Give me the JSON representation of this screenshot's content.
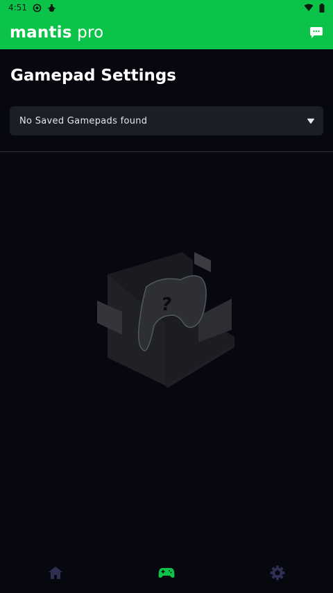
{
  "status_bar": {
    "time": "4:51",
    "icons": [
      "android-system-icon",
      "bug-icon",
      "wifi-icon",
      "battery-icon"
    ]
  },
  "app_bar": {
    "brand_main": "mantis",
    "brand_suffix": "pro",
    "actions": [
      "chat-icon"
    ]
  },
  "page": {
    "title": "Gamepad Settings"
  },
  "gamepad_select": {
    "selected": "No Saved Gamepads found"
  },
  "empty_state": {
    "icon": "empty-gamepad-box-illustration",
    "mark": "?"
  },
  "bottom_nav": {
    "items": [
      {
        "icon": "home-icon",
        "active": false
      },
      {
        "icon": "gamepad-icon",
        "active": true
      },
      {
        "icon": "gear-icon",
        "active": false
      }
    ]
  },
  "colors": {
    "accent": "#0cc34a",
    "background": "#07070f",
    "dropdown_bg": "#1c1e25",
    "nav_inactive": "#2d2f52",
    "nav_active": "#0cc34a"
  }
}
